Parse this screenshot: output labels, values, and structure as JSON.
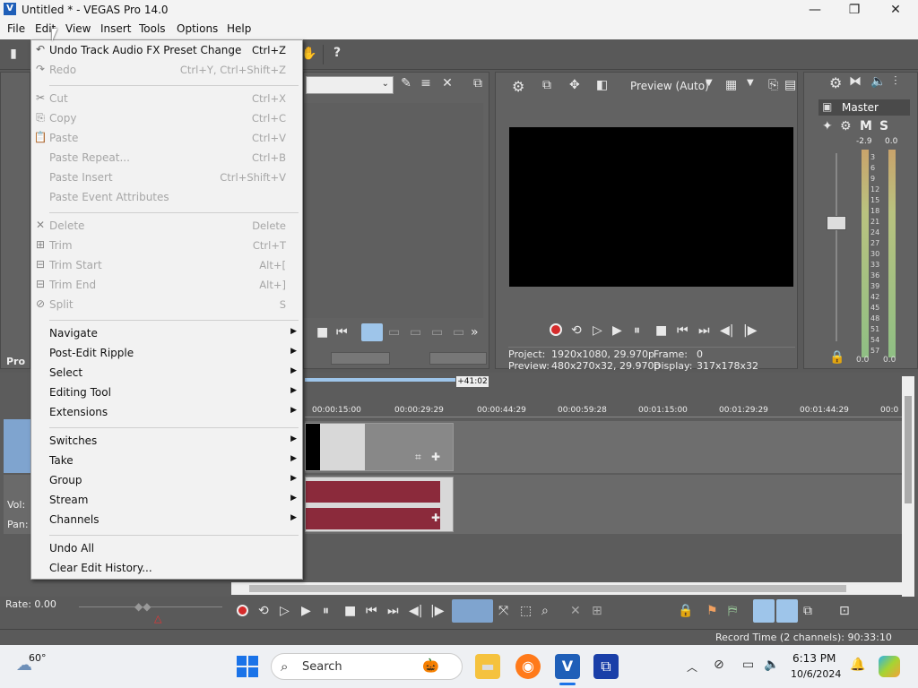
{
  "window": {
    "title": "Untitled * - VEGAS Pro 14.0",
    "minimize": "—",
    "maximize": "❐",
    "close": "✕"
  },
  "menubar": [
    "File",
    "Edit",
    "View",
    "Insert",
    "Tools",
    "Options",
    "Help"
  ],
  "edit_menu": {
    "items": [
      {
        "label": "Undo Track Audio FX Preset Change",
        "shortcut": "Ctrl+Z",
        "disabled": false
      },
      {
        "label": "Redo",
        "shortcut": "Ctrl+Y, Ctrl+Shift+Z",
        "disabled": true
      },
      {
        "label": "Cut",
        "shortcut": "Ctrl+X",
        "disabled": true
      },
      {
        "label": "Copy",
        "shortcut": "Ctrl+C",
        "disabled": true
      },
      {
        "label": "Paste",
        "shortcut": "Ctrl+V",
        "disabled": true
      },
      {
        "label": "Paste Repeat...",
        "shortcut": "Ctrl+B",
        "disabled": true
      },
      {
        "label": "Paste Insert",
        "shortcut": "Ctrl+Shift+V",
        "disabled": true
      },
      {
        "label": "Paste Event Attributes",
        "shortcut": "",
        "disabled": true
      },
      {
        "label": "Delete",
        "shortcut": "Delete",
        "disabled": true
      },
      {
        "label": "Trim",
        "shortcut": "Ctrl+T",
        "disabled": true
      },
      {
        "label": "Trim Start",
        "shortcut": "Alt+[",
        "disabled": true
      },
      {
        "label": "Trim End",
        "shortcut": "Alt+]",
        "disabled": true
      },
      {
        "label": "Split",
        "shortcut": "S",
        "disabled": true
      },
      {
        "label": "Navigate",
        "submenu": true
      },
      {
        "label": "Post-Edit Ripple",
        "submenu": true
      },
      {
        "label": "Select",
        "submenu": true
      },
      {
        "label": "Editing Tool",
        "submenu": true
      },
      {
        "label": "Extensions",
        "submenu": true
      },
      {
        "label": "Switches",
        "submenu": true
      },
      {
        "label": "Take",
        "submenu": true
      },
      {
        "label": "Group",
        "submenu": true
      },
      {
        "label": "Stream",
        "submenu": true
      },
      {
        "label": "Channels",
        "submenu": true
      },
      {
        "label": "Undo All"
      },
      {
        "label": "Clear Edit History..."
      }
    ]
  },
  "preview": {
    "mode": "Preview (Auto)",
    "project_label": "Project:",
    "project_value": "1920x1080, 29.970p",
    "preview_label": "Preview:",
    "preview_value": "480x270x32, 29.970p",
    "frame_label": "Frame:",
    "frame_value": "0",
    "display_label": "Display:",
    "display_value": "317x178x32"
  },
  "mixer": {
    "master_label": "Master",
    "m": "M",
    "s": "S",
    "peak_left": "-2.9",
    "peak_right": "0.0",
    "ticks": [
      "3",
      "6",
      "9",
      "12",
      "15",
      "18",
      "21",
      "24",
      "27",
      "30",
      "33",
      "36",
      "39",
      "42",
      "45",
      "48",
      "51",
      "54",
      "57"
    ],
    "bottom_left": "0.0",
    "bottom_right": "0.0"
  },
  "timeline": {
    "offset_badge": "+41:02",
    "ruler": [
      "00:00:15:00",
      "00:00:29:29",
      "00:00:44:29",
      "00:00:59:28",
      "00:01:15:00",
      "00:01:29:29",
      "00:01:44:29",
      "00:0"
    ],
    "vol_label": "Vol:",
    "pan_label": "Pan:",
    "rate_label": "Rate: 0.00"
  },
  "status": {
    "record_time": "Record Time (2 channels): 90:33:10"
  },
  "explorer_tab": "Pro",
  "taskbar": {
    "weather": "60°",
    "search_placeholder": "Search",
    "time": "6:13 PM",
    "date": "10/6/2024"
  },
  "colors": {
    "accent": "#1f5fb8",
    "audio_wave": "#8b2a3b",
    "app_bg": "#5a5a5a"
  }
}
